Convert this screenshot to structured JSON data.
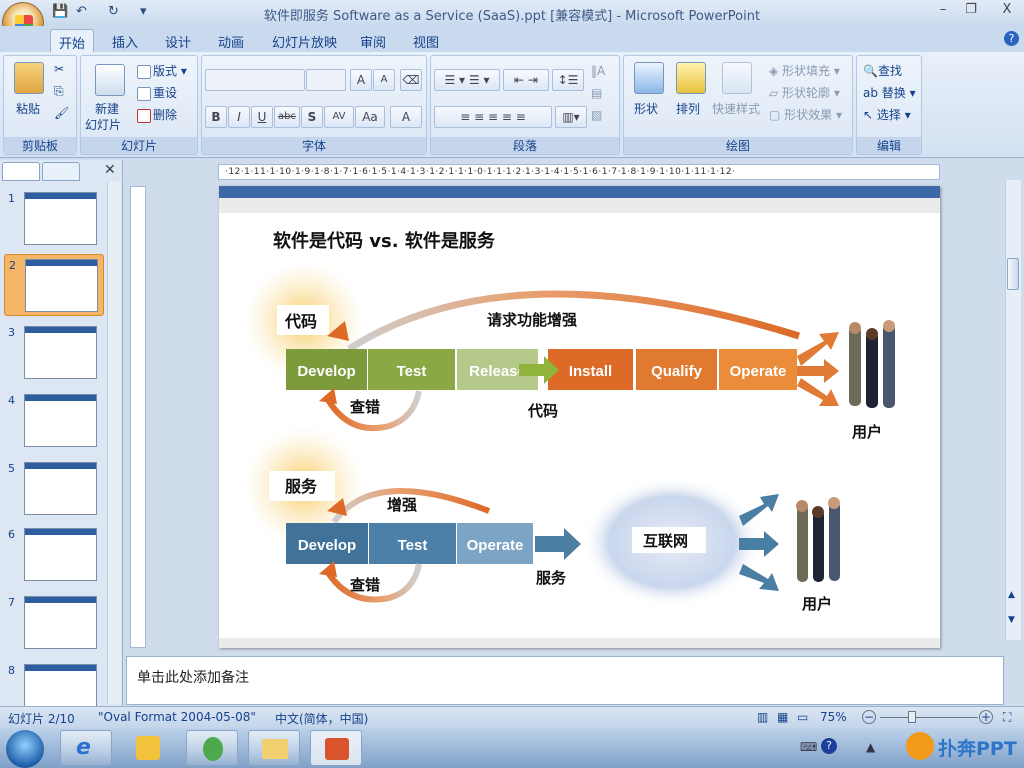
{
  "window": {
    "title": "软件即服务 Software as a Service (SaaS).ppt [兼容模式] - Microsoft PowerPoint",
    "minimize": "–",
    "restore": "❐",
    "close": "X",
    "help": "?"
  },
  "qat": {
    "save": "💾",
    "undo": "↶",
    "redo": "↻",
    "more": "▾"
  },
  "tabs": [
    "开始",
    "插入",
    "设计",
    "动画",
    "幻灯片放映",
    "审阅",
    "视图"
  ],
  "ribbon": {
    "clipboard": {
      "label": "剪贴板",
      "paste": "粘贴"
    },
    "slides": {
      "label": "幻灯片",
      "new_slide": "新建",
      "new_slide2": "幻灯片",
      "layout": "版式",
      "reset": "重设",
      "delete": "删除"
    },
    "font": {
      "label": "字体",
      "bold": "B",
      "italic": "I",
      "underline": "U",
      "strike": "abc",
      "shadow": "S",
      "spacing": "AV",
      "case": "Aa",
      "color": "A",
      "grow": "A",
      "shrink": "A"
    },
    "paragraph": {
      "label": "段落"
    },
    "drawing": {
      "label": "绘图",
      "shapes": "形状",
      "arrange": "排列",
      "quick_styles": "快速样式",
      "fill": "形状填充",
      "outline": "形状轮廓",
      "effects": "形状效果"
    },
    "editing": {
      "label": "编辑",
      "find": "查找",
      "replace": "替换",
      "select": "选择"
    }
  },
  "thumbnails": [
    {
      "n": "1"
    },
    {
      "n": "2",
      "selected": true
    },
    {
      "n": "3"
    },
    {
      "n": "4"
    },
    {
      "n": "5"
    },
    {
      "n": "6"
    },
    {
      "n": "7"
    },
    {
      "n": "8"
    }
  ],
  "ruler": "·12·1·11·1·10·1·9·1·8·1·7·1·6·1·5·1·4·1·3·1·2·1·1·1·0·1·1·1·2·1·3·1·4·1·5·1·6·1·7·1·8·1·9·1·10·1·11·1·12·",
  "slide": {
    "title": "软件是代码 vs. 软件是服务",
    "code": {
      "label": "代码",
      "request": "请求功能增强",
      "debug": "查错",
      "middle": "代码",
      "users": "用户",
      "stages": [
        "Develop",
        "Test",
        "Release",
        "Install",
        "Qualify",
        "Operate"
      ]
    },
    "service": {
      "label": "服务",
      "enhance": "增强",
      "debug": "查错",
      "middle": "服务",
      "internet": "互联网",
      "users": "用户",
      "stages": [
        "Develop",
        "Test",
        "Operate"
      ]
    },
    "colors": {
      "green": "#7d9b3b",
      "orange": "#dd6a26",
      "blue": "#41739a"
    }
  },
  "notes_placeholder": "单击此处添加备注",
  "status": {
    "slide": "幻灯片 2/10",
    "theme": "\"Oval Format  2004-05-08\"",
    "language": "中文(简体，中国)",
    "zoom": "75%",
    "zoom_minus": "−",
    "zoom_plus": "+"
  },
  "watermark": "扑奔PPT"
}
